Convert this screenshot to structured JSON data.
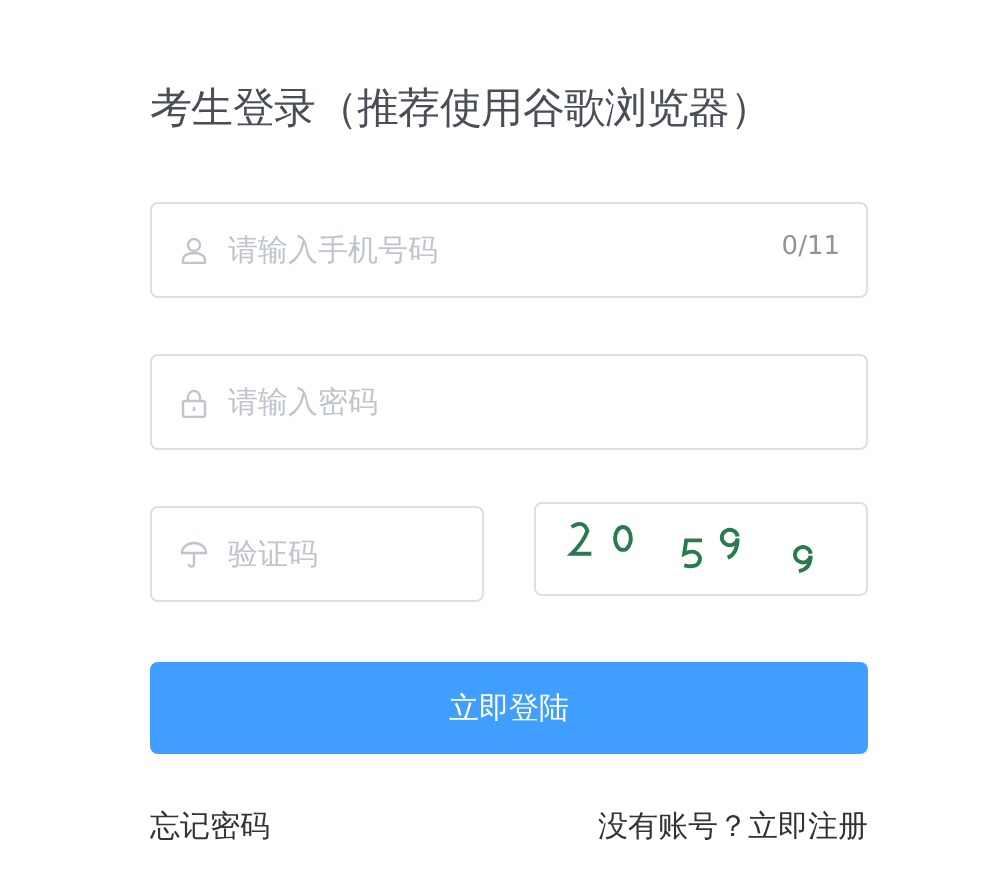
{
  "title": "考生登录（推荐使用谷歌浏览器）",
  "phone": {
    "placeholder": "请输入手机号码",
    "counter": "0/11"
  },
  "password": {
    "placeholder": "请输入密码"
  },
  "captcha": {
    "placeholder": "验证码"
  },
  "submit": "立即登陆",
  "links": [
    {
      "label": "忘记密码"
    },
    {
      "label": "没有账号？立即注册"
    }
  ]
}
